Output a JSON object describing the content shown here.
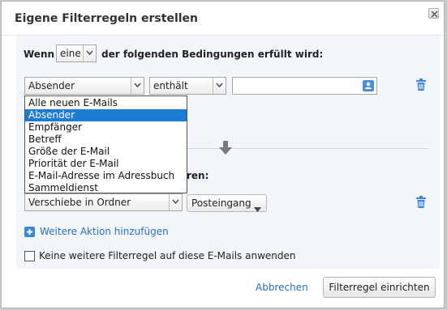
{
  "dialog": {
    "title": "Eigene Filterregeln erstellen"
  },
  "condition": {
    "prefix": "Wenn",
    "match_value": "eine",
    "suffix": "der folgenden Bedingungen erfüllt wird:",
    "field_value": "Absender",
    "operator_value": "enthält",
    "text_value": ""
  },
  "field_options": [
    {
      "label": "Alle neuen E-Mails",
      "selected": false
    },
    {
      "label": "Absender",
      "selected": true
    },
    {
      "label": "Empfänger",
      "selected": false
    },
    {
      "label": "Betreff",
      "selected": false
    },
    {
      "label": "Größe der E-Mail",
      "selected": false
    },
    {
      "label": "Priorität der E-Mail",
      "selected": false
    },
    {
      "label": "E-Mail-Adresse im Adressbuch",
      "selected": false
    },
    {
      "label": "Sammeldienst",
      "selected": false
    }
  ],
  "action": {
    "heading_partial": "ren:",
    "action_value": "Verschiebe in Ordner",
    "folder_value": "Posteingang",
    "add_action_label": "Weitere Aktion hinzufügen"
  },
  "options": {
    "stop_rule_label": "Keine weitere Filterregel auf diese E-Mails anwenden",
    "stop_rule_checked": false
  },
  "footer": {
    "cancel_label": "Abbrechen",
    "submit_label": "Filterregel einrichten"
  },
  "colors": {
    "accent": "#1e7bd3",
    "link": "#2a6ebb",
    "panel_bg": "#f2f6fa"
  }
}
